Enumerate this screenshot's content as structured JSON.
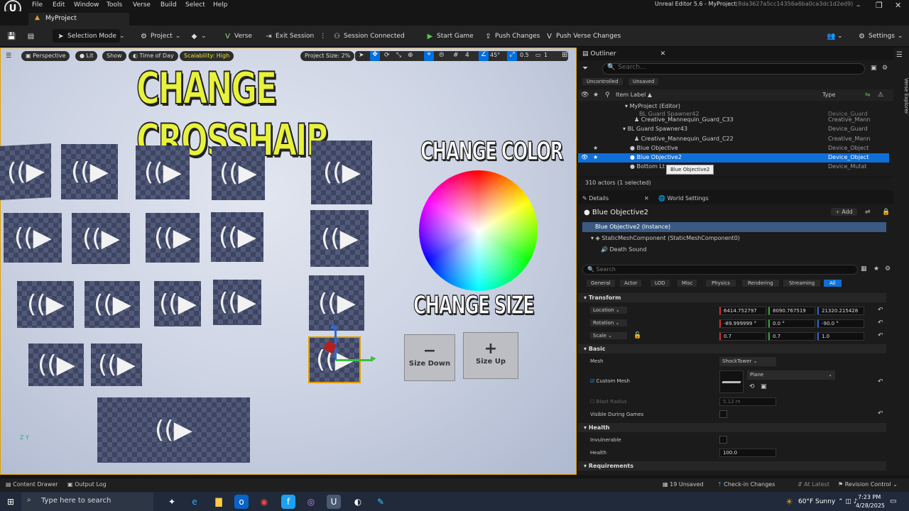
{
  "app": {
    "title": "Unreal Editor 5.6 - MyProject",
    "hash": "(8da3627a5cc14356a6ba0ca3dc1d2ed9)",
    "project_tab": "MyProject"
  },
  "menu": [
    "File",
    "Edit",
    "Window",
    "Tools",
    "Verse",
    "Build",
    "Select",
    "Help"
  ],
  "toolbar": {
    "selection_mode": "Selection Mode",
    "project": "Project",
    "verse": "Verse",
    "exit_session": "Exit Session",
    "session_connected": "Session Connected",
    "start_game": "Start Game",
    "push_changes": "Push Changes",
    "push_verse": "Push Verse Changes",
    "settings": "Settings"
  },
  "viewport": {
    "perspective": "Perspective",
    "lit": "Lit",
    "show": "Show",
    "time_of_day": "Time of Day",
    "scalability": "Scalability: High",
    "project_size": "Project Size: 2%",
    "grid": "4",
    "angle": "45°",
    "scale": "0.5",
    "camera": "1",
    "heading": "CHANGE CROSSHAIR",
    "change_color": "CHANGE COLOR",
    "change_size": "CHANGE SIZE",
    "size_down": "Size Down",
    "size_up": "Size Up",
    "minus": "−",
    "plus": "+",
    "axes": "Z Y",
    "speaker": "◀))"
  },
  "outliner": {
    "title": "Outliner",
    "search_placeholder": "Search...",
    "filter_uncontrolled": "Uncontrolled",
    "filter_unsaved": "Unsaved",
    "col_item": "Item Label ▲",
    "col_type": "Type",
    "rows": [
      {
        "label": "MyProject (Editor)",
        "type": ""
      },
      {
        "label": "BL Guard Spawner42",
        "type": "Device_Guard"
      },
      {
        "label": "Creative_Mannequin_Guard_C33",
        "type": "Creative_Mann"
      },
      {
        "label": "BL Guard Spawner43",
        "type": "Device_Guard"
      },
      {
        "label": "Creative_Mannequin_Guard_C22",
        "type": "Creative_Mann"
      },
      {
        "label": "Blue Objective",
        "type": "Device_Object"
      },
      {
        "label": "Blue Objective2",
        "type": "Device_Object"
      },
      {
        "label": "Bottom Lt",
        "type": "Device_Mutat"
      }
    ],
    "tooltip": "Blue Objective2",
    "count": "310 actors (1 selected)"
  },
  "details": {
    "tab_details": "Details",
    "tab_world": "World Settings",
    "actor": "Blue Objective2",
    "add": "Add",
    "instance": "Blue Objective2 (Instance)",
    "component": "StaticMeshComponent (StaticMeshComponent0)",
    "sound": "Death Sound",
    "search_placeholder": "Search",
    "filters": [
      "General",
      "Actor",
      "LOD",
      "Misc",
      "Physics",
      "Rendering",
      "Streaming",
      "All"
    ],
    "transform": "Transform",
    "location": "Location",
    "rotation": "Rotation",
    "scale": "Scale",
    "loc": [
      "6414.752797",
      "8090.767519",
      "21320.215428"
    ],
    "rot": [
      "-89.999999 °",
      "0.0 °",
      "-90.0 °"
    ],
    "scl": [
      "0.7",
      "0.7",
      "1.0"
    ],
    "basic": "Basic",
    "mesh": "Mesh",
    "mesh_value": "ShockTower",
    "custom_mesh": "Custom Mesh",
    "plane": "Plane",
    "blast_radius": "Blast Radius",
    "blast_value": "5.12 m",
    "visible_during_games": "Visible During Games",
    "health_sect": "Health",
    "invulnerable": "Invulnerable",
    "health": "Health",
    "health_value": "100.0",
    "requirements": "Requirements"
  },
  "side": "Verse Explorer",
  "status": {
    "content_drawer": "Content Drawer",
    "output_log": "Output Log",
    "unsaved": "19 Unsaved",
    "checkin": "Check-in Changes",
    "latest": "At Latest",
    "revision": "Revision Control"
  },
  "taskbar": {
    "search": "Type here to search",
    "weather": "60°F Sunny",
    "time": "7:23 PM",
    "date": "4/28/2025"
  }
}
